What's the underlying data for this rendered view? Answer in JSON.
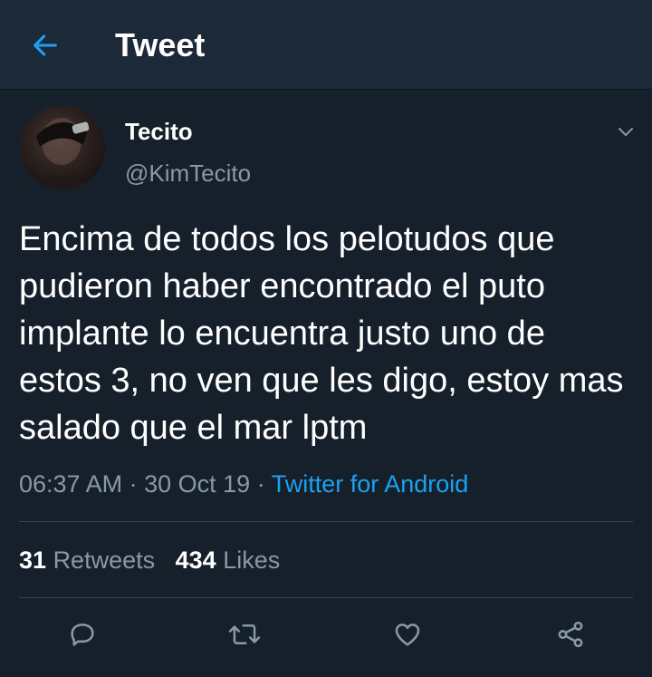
{
  "header": {
    "back_icon": "arrow-left-icon",
    "title": "Tweet",
    "accent_color": "#1da1f2"
  },
  "tweet": {
    "display_name": "Tecito",
    "handle": "@KimTecito",
    "text": "Encima de todos los pelotudos que pudieron haber encontrado el puto implante lo encuentra justo uno de estos 3, no ven que les digo, estoy mas salado que el mar lptm",
    "time": "06:37 AM",
    "separator": "·",
    "date": "30 Oct 19",
    "source": "Twitter for Android"
  },
  "stats": {
    "retweets_count": "31",
    "retweets_label": "Retweets",
    "likes_count": "434",
    "likes_label": "Likes"
  },
  "actions": [
    {
      "icon": "reply-icon"
    },
    {
      "icon": "retweet-icon"
    },
    {
      "icon": "like-heart-icon"
    },
    {
      "icon": "share-icon"
    }
  ],
  "colors": {
    "background": "#15202b",
    "header_bg": "#1c2938",
    "muted": "#8899a6",
    "divider": "#38444d"
  }
}
